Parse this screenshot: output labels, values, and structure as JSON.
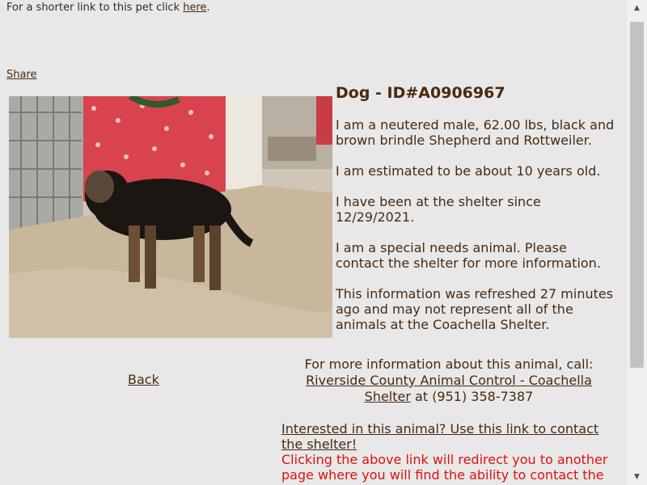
{
  "header": {
    "shorter_link_text": "For a shorter link to this pet click ",
    "shorter_link_label": "here",
    "shorter_link_suffix": ".",
    "share_label": "Share"
  },
  "pet": {
    "title": "Dog - ID#A0906967",
    "description": "I am a neutered male, 62.00 lbs, black and brown brindle Shepherd and Rottweiler.",
    "age": "I am estimated to be about 10 years old.",
    "since": "I have been at the shelter since 12/29/2021.",
    "special_needs": "I am a special needs animal. Please contact the shelter for more information.",
    "refresh_note": "This information was refreshed 27 minutes ago and may not represent all of the animals at the Coachella Shelter."
  },
  "nav": {
    "back_label": "Back"
  },
  "contact": {
    "intro": "For more information about this animal, call:",
    "shelter_link": "Riverside County Animal Control - Coachella Shelter",
    "phone": " at (951) 358-7387"
  },
  "interest": {
    "link_label": "Interested in this animal? Use this link to contact the shelter!",
    "redirect_note": "Clicking the above link will redirect you to another page where you will find the ability to contact the shelter."
  },
  "colors": {
    "text": "#4a2a10",
    "warning": "#e01010",
    "background": "#e8e8e8"
  },
  "icons": {
    "scroll_up": "scroll-up-arrow-icon",
    "scroll_down": "scroll-down-arrow-icon"
  }
}
